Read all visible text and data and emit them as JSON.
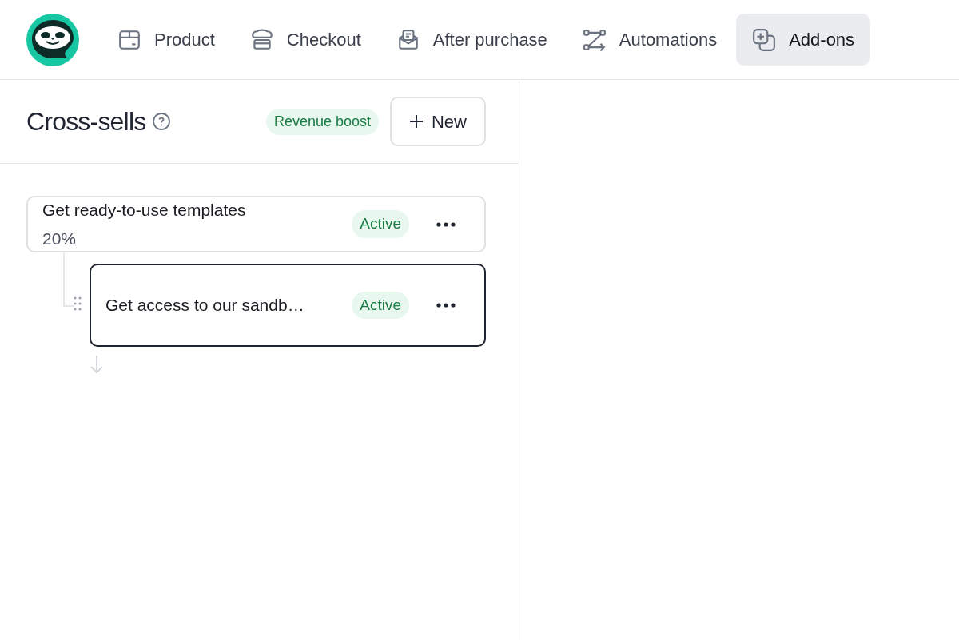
{
  "nav": {
    "tabs": [
      {
        "label": "Product",
        "selected": false
      },
      {
        "label": "Checkout",
        "selected": false
      },
      {
        "label": "After purchase",
        "selected": false
      },
      {
        "label": "Automations",
        "selected": false
      },
      {
        "label": "Add-ons",
        "selected": true
      }
    ]
  },
  "panel": {
    "title": "Cross-sells",
    "badge": "Revenue boost",
    "new_button": "New",
    "offers": [
      {
        "title": "Get ready-to-use templates",
        "subtitle": "20%",
        "status": "Active",
        "selected": false,
        "children": [
          {
            "title": "Get access to our sandb…",
            "status": "Active",
            "selected": true
          }
        ]
      }
    ]
  }
}
